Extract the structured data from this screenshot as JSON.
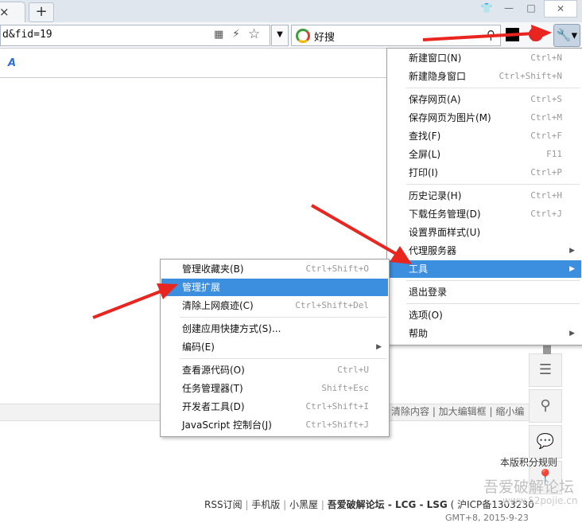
{
  "tabs": {
    "close_glyph": "×",
    "new_tab": "+"
  },
  "window_controls": {
    "skin": "👕",
    "minimize": "—",
    "maximize": "□",
    "close": "✕"
  },
  "address_bar": {
    "url": "d&fid=19"
  },
  "search_bar": {
    "value": "好搜"
  },
  "main_menu": {
    "items": [
      {
        "label": "新建窗口(N)",
        "shortcut": "Ctrl+N"
      },
      {
        "label": "新建隐身窗口",
        "shortcut": "Ctrl+Shift+N"
      },
      {
        "label": "保存网页(A)",
        "shortcut": "Ctrl+S"
      },
      {
        "label": "保存网页为图片(M)",
        "shortcut": "Ctrl+M"
      },
      {
        "label": "查找(F)",
        "shortcut": "Ctrl+F"
      },
      {
        "label": "全屏(L)",
        "shortcut": "F11"
      },
      {
        "label": "打印(I)",
        "shortcut": "Ctrl+P"
      },
      {
        "label": "历史记录(H)",
        "shortcut": "Ctrl+H"
      },
      {
        "label": "下载任务管理(D)",
        "shortcut": "Ctrl+J"
      },
      {
        "label": "设置界面样式(U)",
        "shortcut": ""
      },
      {
        "label": "代理服务器",
        "shortcut": ""
      },
      {
        "label": "工具",
        "shortcut": ""
      },
      {
        "label": "退出登录",
        "shortcut": ""
      },
      {
        "label": "选项(O)",
        "shortcut": ""
      },
      {
        "label": "帮助",
        "shortcut": ""
      }
    ]
  },
  "tools_submenu": {
    "items": [
      {
        "label": "管理收藏夹(B)",
        "shortcut": "Ctrl+Shift+O"
      },
      {
        "label": "管理扩展",
        "shortcut": ""
      },
      {
        "label": "清除上网痕迹(C)",
        "shortcut": "Ctrl+Shift+Del"
      },
      {
        "label": "创建应用快捷方式(S)...",
        "shortcut": ""
      },
      {
        "label": "编码(E)",
        "shortcut": ""
      },
      {
        "label": "查看源代码(O)",
        "shortcut": "Ctrl+U"
      },
      {
        "label": "任务管理器(T)",
        "shortcut": "Shift+Esc"
      },
      {
        "label": "开发者工具(D)",
        "shortcut": "Ctrl+Shift+I"
      },
      {
        "label": "JavaScript 控制台(J)",
        "shortcut": "Ctrl+Shift+J"
      }
    ]
  },
  "page": {
    "editor_links": "清除内容  |  加大编辑框 | 缩小编",
    "copyright": "本版积分规则",
    "footer_rss": "RSS订阅",
    "footer_mobile": "手机版",
    "footer_darkroom": "小黑屋",
    "footer_brand": "吾爱破解论坛 - LCG - LSG",
    "footer_icp": "( 沪ICP备1303230",
    "footer_gmt": "GMT+8, 2015-9-23",
    "watermark": "吾爱破解论坛",
    "watermark_url": "www.52pojie.cn"
  },
  "accent": "#3c8fde",
  "arrow_color": "#e8251f"
}
